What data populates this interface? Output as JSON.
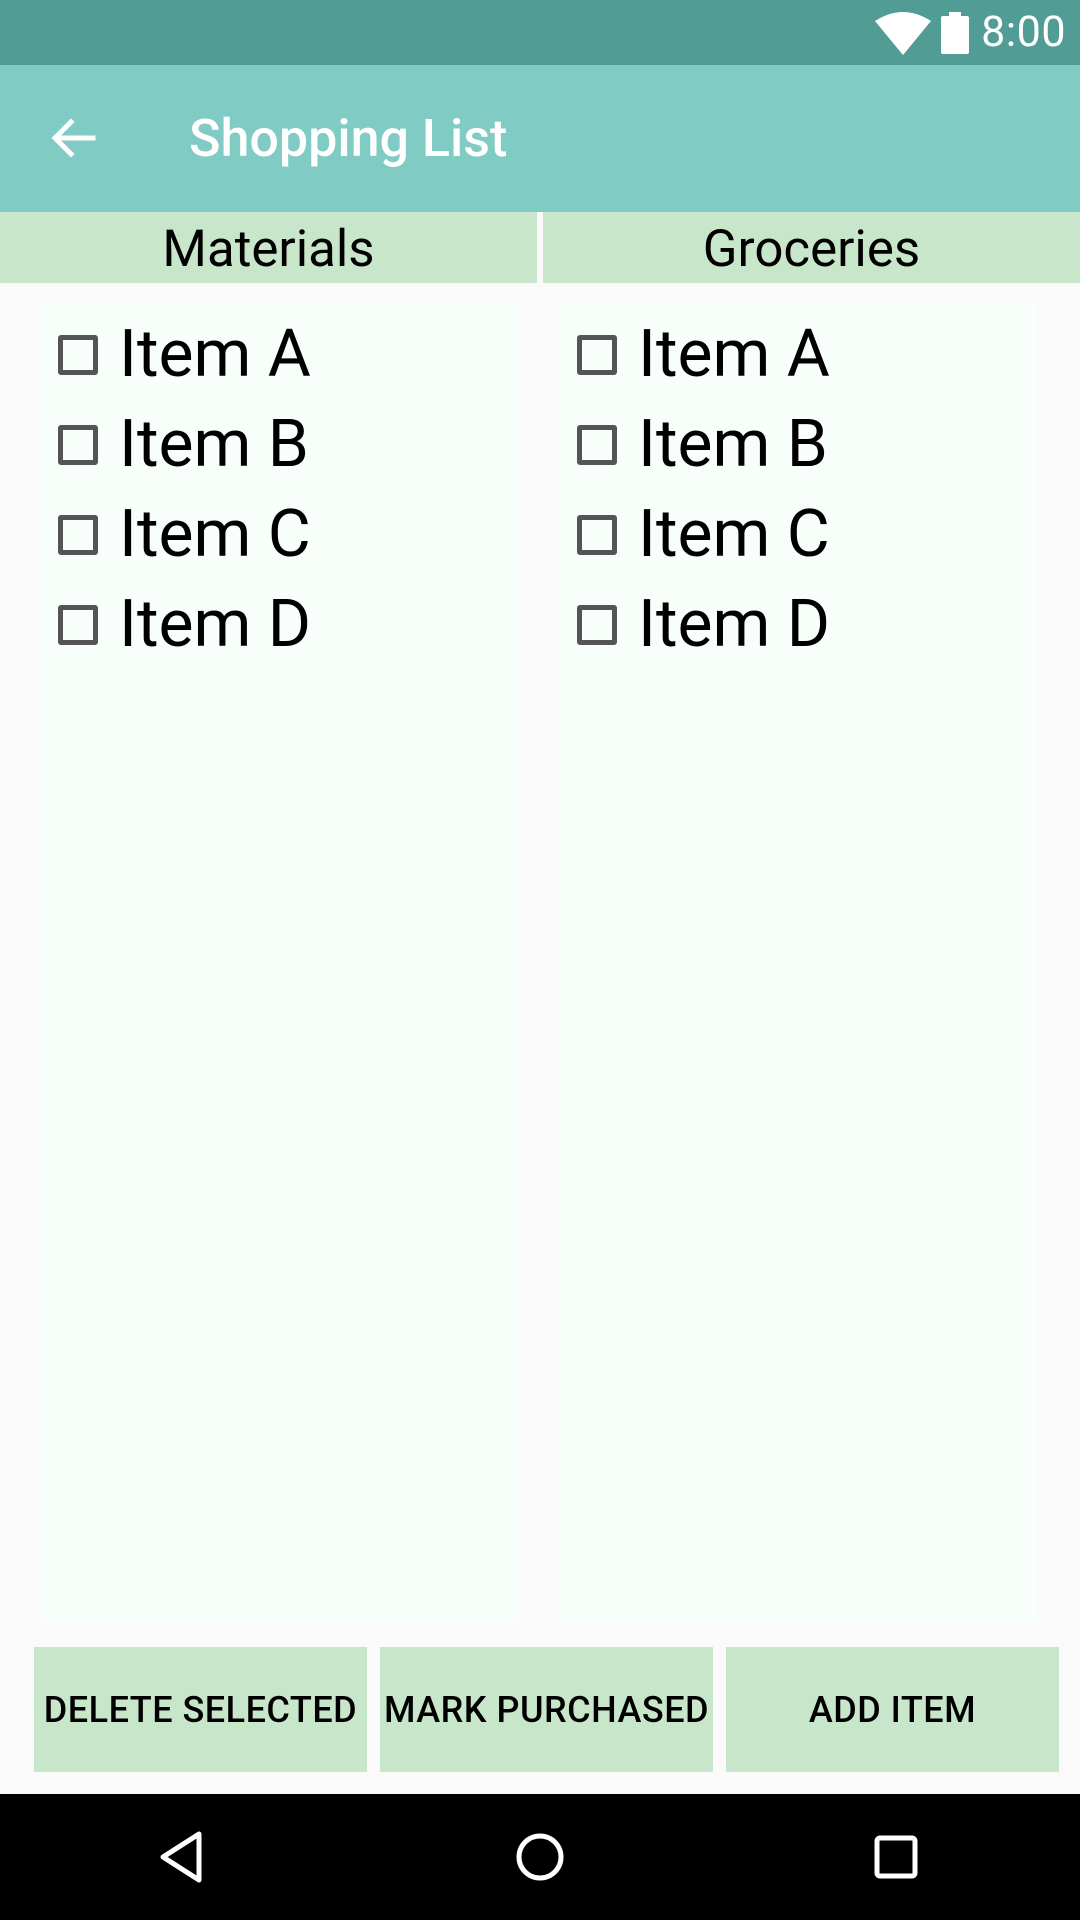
{
  "status_bar": {
    "time": "8:00",
    "icons": [
      "wifi-icon",
      "battery-icon"
    ]
  },
  "app_bar": {
    "title": "Shopping List",
    "back_icon": "arrow-back-icon"
  },
  "tabs": [
    {
      "label": "Materials"
    },
    {
      "label": "Groceries"
    }
  ],
  "lists": {
    "materials": {
      "items": [
        {
          "label": "Item A",
          "checked": false
        },
        {
          "label": "Item B",
          "checked": false
        },
        {
          "label": "Item C",
          "checked": false
        },
        {
          "label": "Item D",
          "checked": false
        }
      ]
    },
    "groceries": {
      "items": [
        {
          "label": "Item A",
          "checked": false
        },
        {
          "label": "Item B",
          "checked": false
        },
        {
          "label": "Item C",
          "checked": false
        },
        {
          "label": "Item D",
          "checked": false
        }
      ]
    }
  },
  "actions": {
    "delete_label": "DELETE SELECTED",
    "mark_label": "MARK PURCHASED",
    "add_label": "ADD ITEM"
  },
  "nav_bar": {
    "icons": [
      "nav-back-icon",
      "nav-home-icon",
      "nav-recents-icon"
    ]
  },
  "colors": {
    "status_bar": "#529C96",
    "app_bar": "#80CBC4",
    "tab_and_button": "#C8E6C9",
    "list_panel": "#F8FFFA",
    "background": "#FAFAFA"
  }
}
